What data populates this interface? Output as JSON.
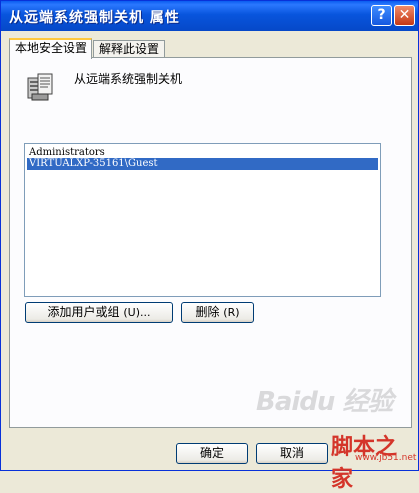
{
  "window": {
    "title": "从远端系统强制关机 属性",
    "help_button": "?",
    "close_button": "✕"
  },
  "tabs": [
    {
      "label": "本地安全设置",
      "active": true
    },
    {
      "label": "解释此设置",
      "active": false
    }
  ],
  "policy": {
    "icon": "server-policy-icon",
    "name": "从远端系统强制关机"
  },
  "members": {
    "items": [
      {
        "label": "Administrators",
        "selected": false
      },
      {
        "label": "VIRTUALXP-35161\\Guest",
        "selected": true
      }
    ]
  },
  "actions": {
    "add_label": "添加用户或组",
    "add_accel": "(U)...",
    "remove_label": "删除",
    "remove_accel": "(R)"
  },
  "footer": {
    "ok_label": "确定",
    "cancel_label": "取消"
  },
  "watermarks": {
    "baidu": "Baidu 经验",
    "site_name": "脚本之家",
    "site_url": "www.jb51.net"
  },
  "colors": {
    "titlebar": "#0855dd",
    "selection": "#316ac5",
    "tab_highlight": "#ffc83c",
    "site_red": "#d4352a"
  }
}
